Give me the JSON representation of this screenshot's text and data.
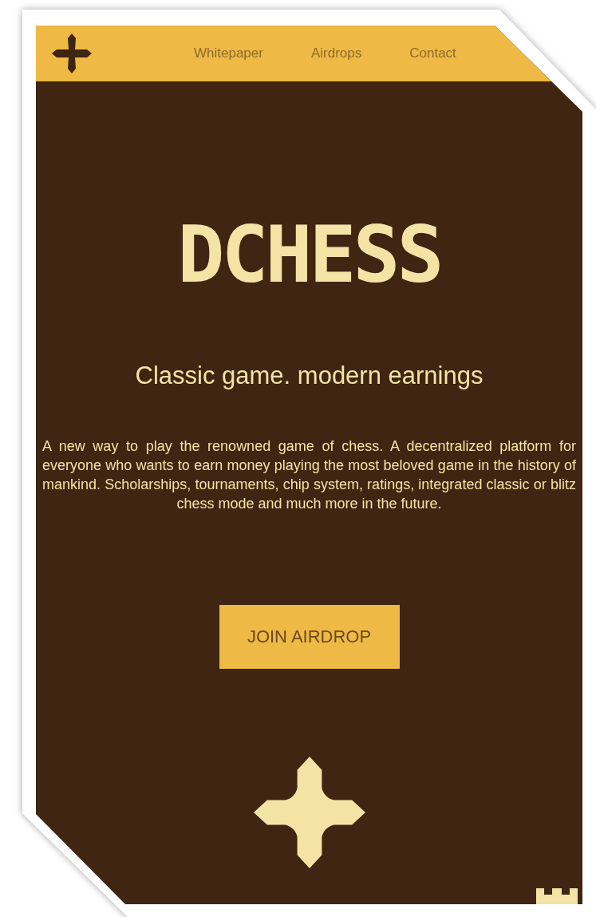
{
  "nav": {
    "links": [
      {
        "label": "Whitepaper"
      },
      {
        "label": "Airdrops"
      },
      {
        "label": "Contact"
      }
    ]
  },
  "hero": {
    "logo": "DCHESS",
    "tagline": "Classic game. modern earnings",
    "description": "A new way to play the renowned game of chess. A decentralized platform for everyone who wants to earn money playing the most beloved game in the history of mankind. Scholarships, tournaments, chip system, ratings, integrated classic or blitz chess mode and much more in the future.",
    "button": "JOIN AIRDROP"
  }
}
